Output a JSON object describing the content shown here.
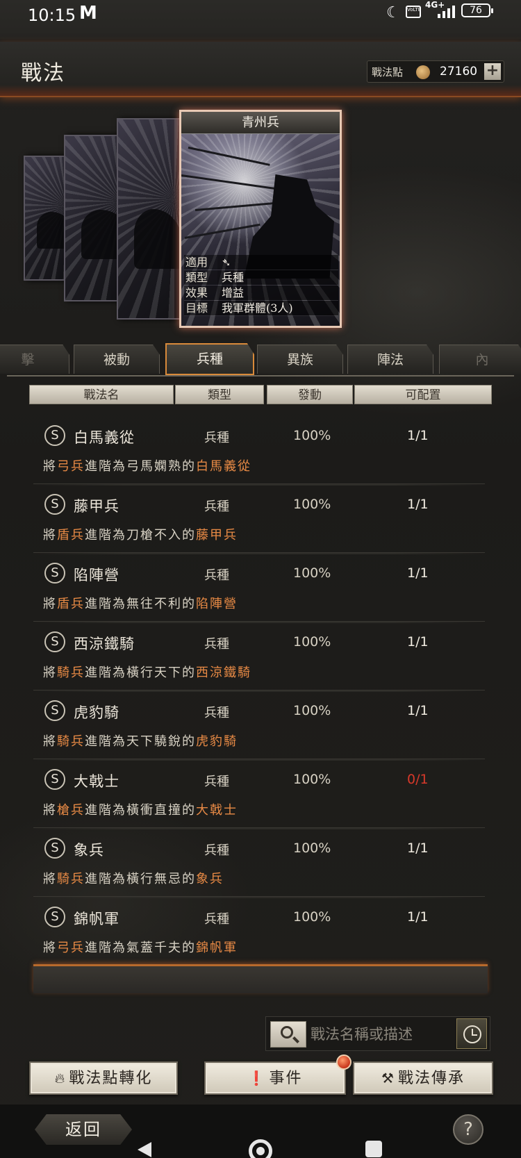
{
  "status_bar": {
    "time": "10:15",
    "app_icon": "M",
    "network": "4G+",
    "battery": "76",
    "volte": "VoLTE"
  },
  "header": {
    "title": "戰法",
    "points_label": "戰法點",
    "points_value": "27160",
    "add_label": "+"
  },
  "featured_card": {
    "name": "青州兵",
    "rows": [
      {
        "key": "適用",
        "value": ""
      },
      {
        "key": "類型",
        "value": "兵種"
      },
      {
        "key": "效果",
        "value": "增益"
      },
      {
        "key": "目標",
        "value": "我軍群體(3人)"
      }
    ]
  },
  "tabs": [
    {
      "label": "擊",
      "state": "faded"
    },
    {
      "label": "被動",
      "state": "normal"
    },
    {
      "label": "兵種",
      "state": "active"
    },
    {
      "label": "異族",
      "state": "normal"
    },
    {
      "label": "陣法",
      "state": "normal"
    },
    {
      "label": "內",
      "state": "faded"
    }
  ],
  "columns": [
    "戰法名",
    "類型",
    "發動",
    "可配置"
  ],
  "skills": [
    {
      "grade": "S",
      "name": "白馬義從",
      "type": "兵種",
      "rate": "100%",
      "avail": "1/1",
      "zero": false,
      "desc_pre": "將",
      "desc_unit": "弓兵",
      "desc_mid": "進階為弓馬嫻熟的",
      "desc_target": "白馬義從"
    },
    {
      "grade": "S",
      "name": "藤甲兵",
      "type": "兵種",
      "rate": "100%",
      "avail": "1/1",
      "zero": false,
      "desc_pre": "將",
      "desc_unit": "盾兵",
      "desc_mid": "進階為刀槍不入的",
      "desc_target": "藤甲兵"
    },
    {
      "grade": "S",
      "name": "陷陣營",
      "type": "兵種",
      "rate": "100%",
      "avail": "1/1",
      "zero": false,
      "desc_pre": "將",
      "desc_unit": "盾兵",
      "desc_mid": "進階為無往不利的",
      "desc_target": "陷陣營"
    },
    {
      "grade": "S",
      "name": "西涼鐵騎",
      "type": "兵種",
      "rate": "100%",
      "avail": "1/1",
      "zero": false,
      "desc_pre": "將",
      "desc_unit": "騎兵",
      "desc_mid": "進階為橫行天下的",
      "desc_target": "西涼鐵騎"
    },
    {
      "grade": "S",
      "name": "虎豹騎",
      "type": "兵種",
      "rate": "100%",
      "avail": "1/1",
      "zero": false,
      "desc_pre": "將",
      "desc_unit": "騎兵",
      "desc_mid": "進階為天下驍銳的",
      "desc_target": "虎豹騎"
    },
    {
      "grade": "S",
      "name": "大戟士",
      "type": "兵種",
      "rate": "100%",
      "avail": "0/1",
      "zero": true,
      "desc_pre": "將",
      "desc_unit": "槍兵",
      "desc_mid": "進階為橫衝直撞的",
      "desc_target": "大戟士"
    },
    {
      "grade": "S",
      "name": "象兵",
      "type": "兵種",
      "rate": "100%",
      "avail": "1/1",
      "zero": false,
      "desc_pre": "將",
      "desc_unit": "騎兵",
      "desc_mid": "進階為橫行無忌的",
      "desc_target": "象兵"
    },
    {
      "grade": "S",
      "name": "錦帆軍",
      "type": "兵種",
      "rate": "100%",
      "avail": "1/1",
      "zero": false,
      "desc_pre": "將",
      "desc_unit": "弓兵",
      "desc_mid": "進階為氣蓋千夫的",
      "desc_target": "錦帆軍"
    }
  ],
  "search": {
    "placeholder": "戰法名稱或描述",
    "value": ""
  },
  "buttons": {
    "convert": "戰法點轉化",
    "events": "事件",
    "inherit": "戰法傳承"
  },
  "nav": {
    "back": "返回",
    "help": "?"
  },
  "colors": {
    "highlight": "#e88a45",
    "active_tab_border": "#d98a3a",
    "zero_avail": "#d8392a"
  }
}
